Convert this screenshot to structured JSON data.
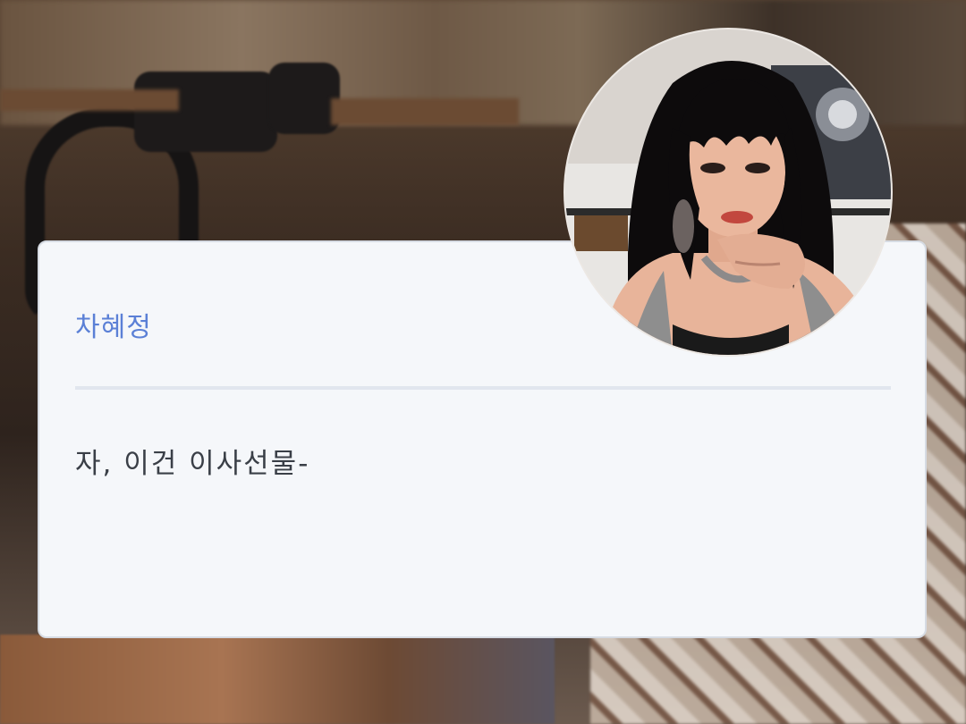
{
  "dialog": {
    "speaker_name": "차혜정",
    "message": "자, 이건 이사선물-"
  },
  "colors": {
    "name_color": "#5b80d6",
    "text_color": "#3a3f47",
    "card_bg": "#f5f7fa",
    "divider": "#e1e6ee"
  },
  "icons": {
    "avatar": "character-portrait"
  }
}
